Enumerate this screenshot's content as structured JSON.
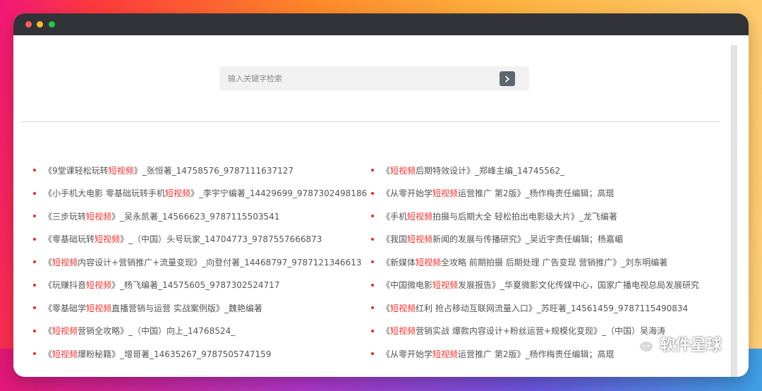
{
  "search": {
    "placeholder": "输入关键字检索"
  },
  "colors": {
    "accent": "#e8312f",
    "bullet": "#e02c2c",
    "titlebar": "#323339"
  },
  "icons": {
    "search_button": "chevron-right-icon"
  },
  "books_left": [
    {
      "pre": "《9堂课轻松玩转",
      "hl": "短视频",
      "post": "》_张恒著_14758576_9787111637127"
    },
    {
      "pre": "《小手机大电影 零基础玩转手机",
      "hl": "短视频",
      "post": "》_李宇宁编著_14429699_9787302498186"
    },
    {
      "pre": "《三步玩转",
      "hl": "短视频",
      "post": "》_吴永凯著_14566623_9787115503541"
    },
    {
      "pre": "《零基础玩转",
      "hl": "短视频",
      "post": "》_（中国）头号玩家_14704773_9787557666873"
    },
    {
      "pre": "《",
      "hl": "短视频",
      "post": " 内容设计+营销推广+流量变现》_向登付著_14468797_9787121346613"
    },
    {
      "pre": "《玩赚抖音",
      "hl": "短视频",
      "post": "》_杨飞编著_14575605_9787302524717"
    },
    {
      "pre": "《零基础学",
      "hl": "短视频",
      "post": "直播营销与运营 实战案例版》_魏艳编著"
    },
    {
      "pre": "《",
      "hl": "短视频",
      "post": "营销全攻略》_（中国）向上_14768524_"
    },
    {
      "pre": "《",
      "hl": "短视频",
      "post": "爆粉秘籍》_增哥著_14635267_9787505747159"
    }
  ],
  "books_right": [
    {
      "pre": "《",
      "hl": "短视频",
      "post": "后期特效设计》_郑峰主编_14745562_"
    },
    {
      "pre": "《从零开始学",
      "hl": "短视频",
      "post": "运营推广 第2版》_杨作梅责任编辑；高琨"
    },
    {
      "pre": "《手机",
      "hl": "短视频",
      "post": "拍摄与后期大全 轻松拍出电影级大片》_龙飞编著"
    },
    {
      "pre": "《我国",
      "hl": "短视频",
      "post": "新闻的发展与传播研究》_吴近宇责任编辑；杨嘉嵋"
    },
    {
      "pre": "《新媒体",
      "hl": "短视频",
      "post": "全攻略 前期拍摄 后期处理 广告变现 营销推广》_刘东明编著"
    },
    {
      "pre": "《中国微电影",
      "hl": "短视频",
      "post": "发展报告》_华夏微影文化传媒中心，国家广播电视总局发展研究"
    },
    {
      "pre": "《",
      "hl": "短视频",
      "post": "红利 抢占移动互联网流量入口》_苏旺著_14561459_9787115490834"
    },
    {
      "pre": "《",
      "hl": "短视频",
      "post": "营销实战 爆款内容设计+粉丝运营+规模化变现》_（中国）吴海涛"
    },
    {
      "pre": "《从零开始学",
      "hl": "短视频",
      "post": "运营推广 第2版》_杨作梅责任编辑；高琨"
    }
  ],
  "watermark": {
    "text": "软件星球"
  }
}
